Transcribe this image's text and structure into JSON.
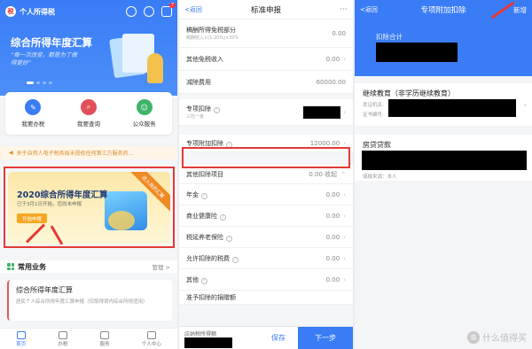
{
  "panel1": {
    "app_title": "个人所得税",
    "logo_glyph": "税",
    "notification_count": "7",
    "banner": {
      "title": "综合所得年度汇算",
      "subtitle": "“每一次改变，都是为了做得更好”"
    },
    "quick_actions": [
      {
        "label": "我要办税",
        "icon": "edit-icon",
        "color": "#3a7cf6",
        "glyph": "✎"
      },
      {
        "label": "我要查询",
        "icon": "search-icon",
        "color": "#e0505a",
        "glyph": "⌕"
      },
      {
        "label": "公众服务",
        "icon": "service-icon",
        "color": "#3fb46b",
        "glyph": "☺"
      }
    ],
    "notice": "关于自然人电子税务局未授权任何第三方服务的...",
    "annual_card": {
      "title": "2020综合所得年度汇算",
      "subtitle": "已于3月1日开始，您尚未申报",
      "button": "开始申报",
      "ribbon": "进入我的汇算"
    },
    "section": {
      "title": "常用业务",
      "manage": "管理 >"
    },
    "business": {
      "title": "综合所得年度汇算",
      "desc": "居民个人综合所得年度汇算申报（仅取得境内综合所得适用）"
    },
    "tabs": [
      {
        "label": "首页",
        "active": true
      },
      {
        "label": "办税",
        "active": false
      },
      {
        "label": "服务",
        "active": false
      },
      {
        "label": "个人中心",
        "active": false
      }
    ]
  },
  "panel2": {
    "back": "<返回",
    "title": "标准申报",
    "more": "···",
    "rows": {
      "royalty_label": "稿酬所得免税部分",
      "royalty_sub": "稿酬收入×(1-20%)×30%",
      "royalty_val": "0.00",
      "other_exempt_label": "其他免税收入",
      "other_exempt_val": "0.00",
      "deduction_label": "减除费用",
      "deduction_val": "60000.00",
      "special_label": "专项扣除",
      "special_sub": "三险一金",
      "special_add_label": "专项附加扣除",
      "special_add_val": "12000.00",
      "other_items_label": "其他扣除项目",
      "other_items_val": "0.00 收起",
      "annuity_label": "年金",
      "annuity_val": "0.00",
      "health_label": "商业健康险",
      "health_val": "0.00",
      "pension_label": "税延养老保险",
      "pension_val": "0.00",
      "allowed_tax_label": "允许扣除的税费",
      "allowed_tax_val": "0.00",
      "other_label": "其他",
      "other_val": "0.00",
      "partial_label": "准予扣除的捐赠额"
    },
    "bottom": {
      "taxable_label": "应纳税所得额",
      "save": "保存",
      "next": "下一步"
    }
  },
  "panel3": {
    "back": "<返回",
    "title": "专项附加扣除",
    "add": "新增",
    "total_label": "扣除合计",
    "edu": {
      "title": "继续教育（非学历继续教育）",
      "issuer_label": "发证机关:",
      "cert_label": "证书编号:"
    },
    "loan": {
      "title": "房贷贷款",
      "source": "填报来源：本人"
    }
  },
  "watermark": {
    "glyph": "值",
    "text": "什么值得买"
  },
  "colors": {
    "primary": "#3a7cf6",
    "highlight": "#e53935",
    "orange": "#f6a623"
  }
}
